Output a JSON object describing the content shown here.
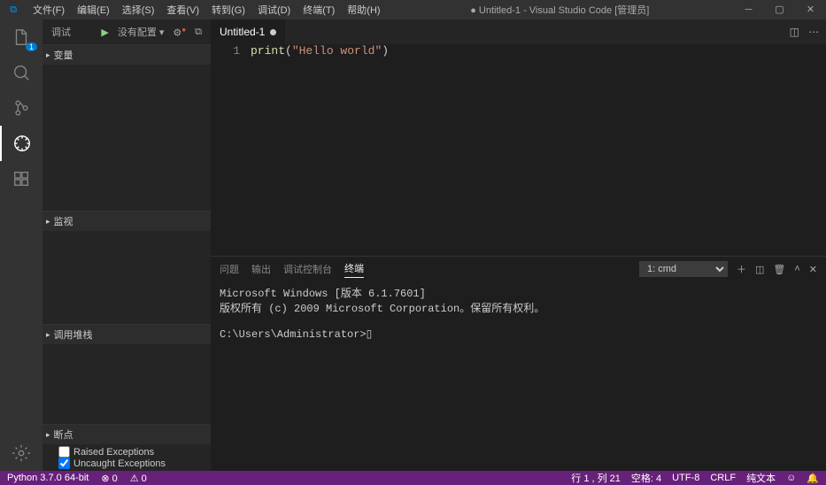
{
  "title": "● Untitled-1 - Visual Studio Code [管理员]",
  "menu": [
    "文件(F)",
    "编辑(E)",
    "选择(S)",
    "查看(V)",
    "转到(G)",
    "调试(D)",
    "终端(T)",
    "帮助(H)"
  ],
  "activity": {
    "explorer_badge": "1"
  },
  "side": {
    "title": "调试",
    "no_config": "没有配置",
    "sections": {
      "variables": "变量",
      "watch": "监视",
      "callstack": "调用堆栈",
      "breakpoints": "断点"
    },
    "bp1": "Raised Exceptions",
    "bp2": "Uncaught Exceptions"
  },
  "tabs": {
    "untitled": "Untitled-1"
  },
  "editor": {
    "line_no": "1",
    "code_fn": "print",
    "code_paren1": "(",
    "code_str": "\"Hello world\"",
    "code_paren2": ")"
  },
  "panel": {
    "tabs": [
      "问题",
      "输出",
      "调试控制台",
      "终端"
    ],
    "select": "1: cmd",
    "line1": "Microsoft Windows [版本 6.1.7601]",
    "line2": "版权所有 (c) 2009 Microsoft Corporation。保留所有权利。",
    "prompt": "C:\\Users\\Administrator>"
  },
  "status": {
    "python": "Python 3.7.0 64-bit",
    "errors": "⊗ 0",
    "warnings": "⚠ 0",
    "ln_col": "行 1 , 列 21",
    "spaces": "空格: 4",
    "encoding": "UTF-8",
    "eol": "CRLF",
    "lang": "纯文本",
    "smile": "☺",
    "bell": "🔔"
  }
}
